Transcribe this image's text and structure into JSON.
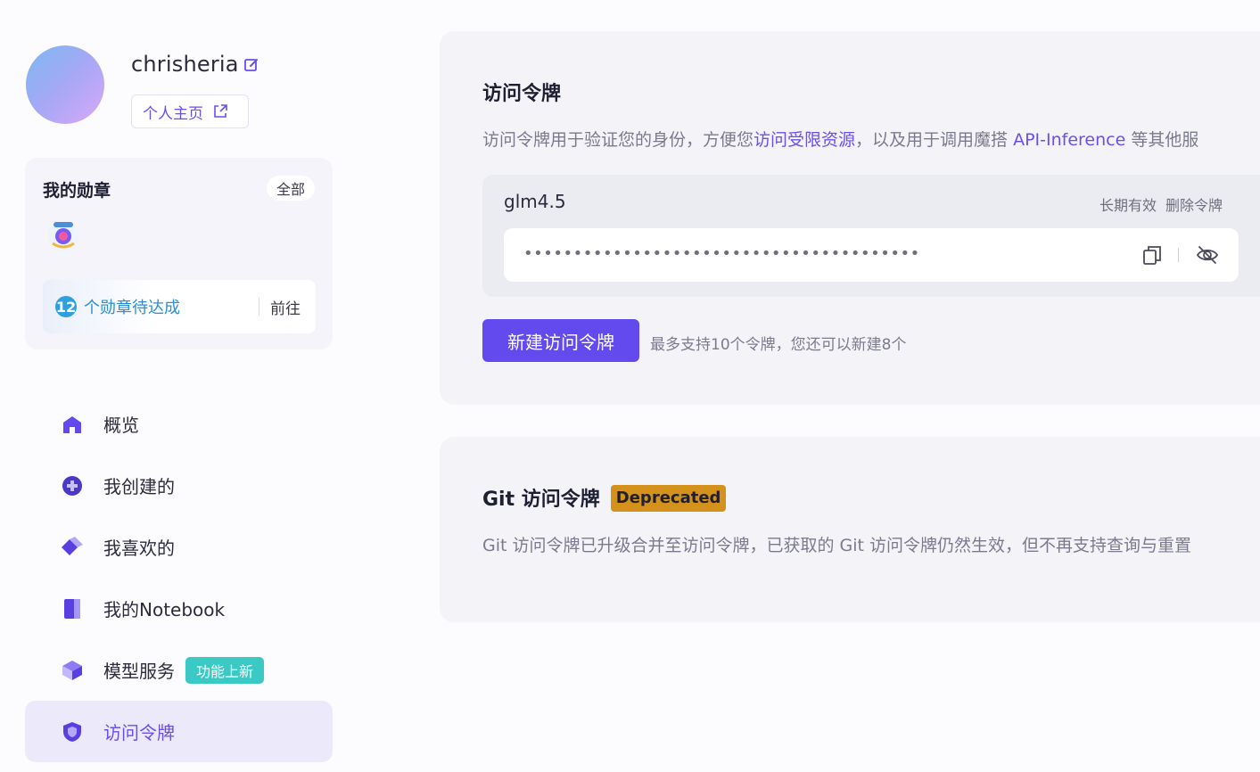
{
  "profile": {
    "username": "chrisheria",
    "homepage_label": "个人主页"
  },
  "badges": {
    "title": "我的勋章",
    "all_label": "全部",
    "pending_count": "12",
    "pending_text": "个勋章待达成",
    "go_label": "前往"
  },
  "nav": {
    "items": [
      {
        "label": "概览",
        "icon": "home-icon"
      },
      {
        "label": "我创建的",
        "icon": "plus-circle-icon"
      },
      {
        "label": "我喜欢的",
        "icon": "diamond-icon"
      },
      {
        "label": "我的Notebook",
        "icon": "notebook-icon"
      },
      {
        "label": "模型服务",
        "icon": "cube-icon",
        "tag": "功能上新"
      },
      {
        "label": "访问令牌",
        "icon": "shield-icon",
        "active": true
      }
    ]
  },
  "access_token": {
    "title": "访问令牌",
    "desc_prefix": "访问令牌用于验证您的身份，方便您",
    "desc_link1": "访问受限资源",
    "desc_middle": "，以及用于调用魔搭 ",
    "desc_link2": "API-Inference",
    "desc_suffix": " 等其他服",
    "token": {
      "name": "glm4.5",
      "validity": "长期有效",
      "delete_label": "删除令牌",
      "masked_value": "••••••••••••••••••••••••••••••••••••••••"
    },
    "new_button": "新建访问令牌",
    "hint": "最多支持10个令牌，您还可以新建8个"
  },
  "git_token": {
    "title": "Git 访问令牌",
    "badge": "Deprecated",
    "desc": "Git 访问令牌已升级合并至访问令牌，已获取的 Git 访问令牌仍然生效，但不再支持查询与重置"
  },
  "colors": {
    "accent": "#624aef",
    "link": "#6a4ff0",
    "deprecated_badge": "#d4921c",
    "new_feature_tag": "#3ac9c4"
  }
}
